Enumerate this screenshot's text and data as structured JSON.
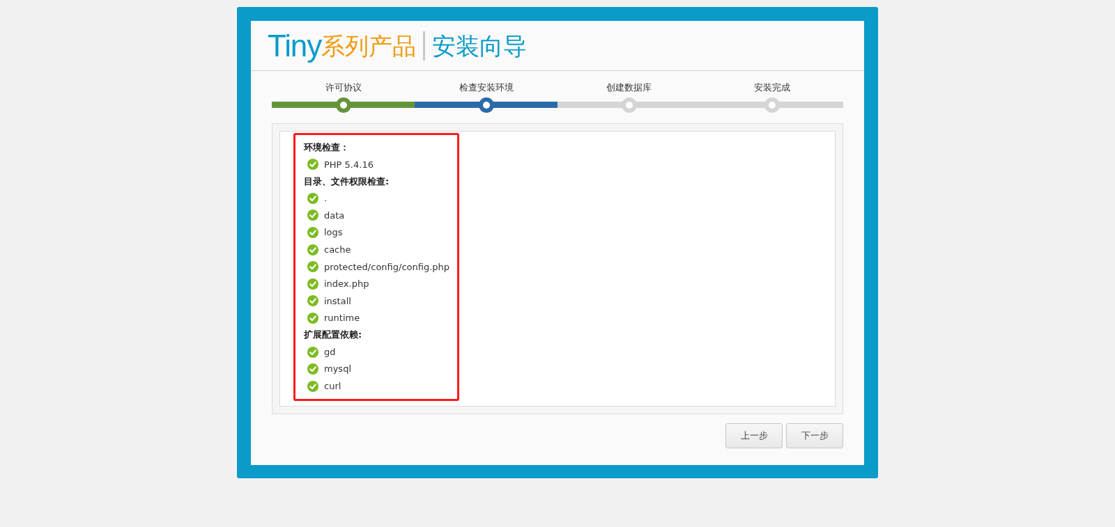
{
  "logo": {
    "brand": "Tiny",
    "series": "系列产品",
    "title": "安装向导"
  },
  "steps": [
    {
      "label": "许可协议",
      "done": true,
      "selected": false
    },
    {
      "label": "检查安装环境",
      "done": false,
      "selected": true
    },
    {
      "label": "创建数据库",
      "done": false,
      "selected": false
    },
    {
      "label": "安装完成",
      "done": false,
      "selected": false
    }
  ],
  "checks": [
    {
      "heading": "环境检查：",
      "items": [
        {
          "text": "PHP 5.4.16",
          "ok": true
        }
      ]
    },
    {
      "heading": "目录、文件权限检查:",
      "items": [
        {
          "text": ".",
          "ok": true
        },
        {
          "text": "data",
          "ok": true
        },
        {
          "text": "logs",
          "ok": true
        },
        {
          "text": "cache",
          "ok": true
        },
        {
          "text": "protected/config/config.php",
          "ok": true
        },
        {
          "text": "index.php",
          "ok": true
        },
        {
          "text": "install",
          "ok": true
        },
        {
          "text": "runtime",
          "ok": true
        }
      ]
    },
    {
      "heading": "扩展配置依赖:",
      "items": [
        {
          "text": "gd",
          "ok": true
        },
        {
          "text": "mysql",
          "ok": true
        },
        {
          "text": "curl",
          "ok": true
        }
      ]
    }
  ],
  "buttons": [
    "上一步",
    "下一步"
  ]
}
